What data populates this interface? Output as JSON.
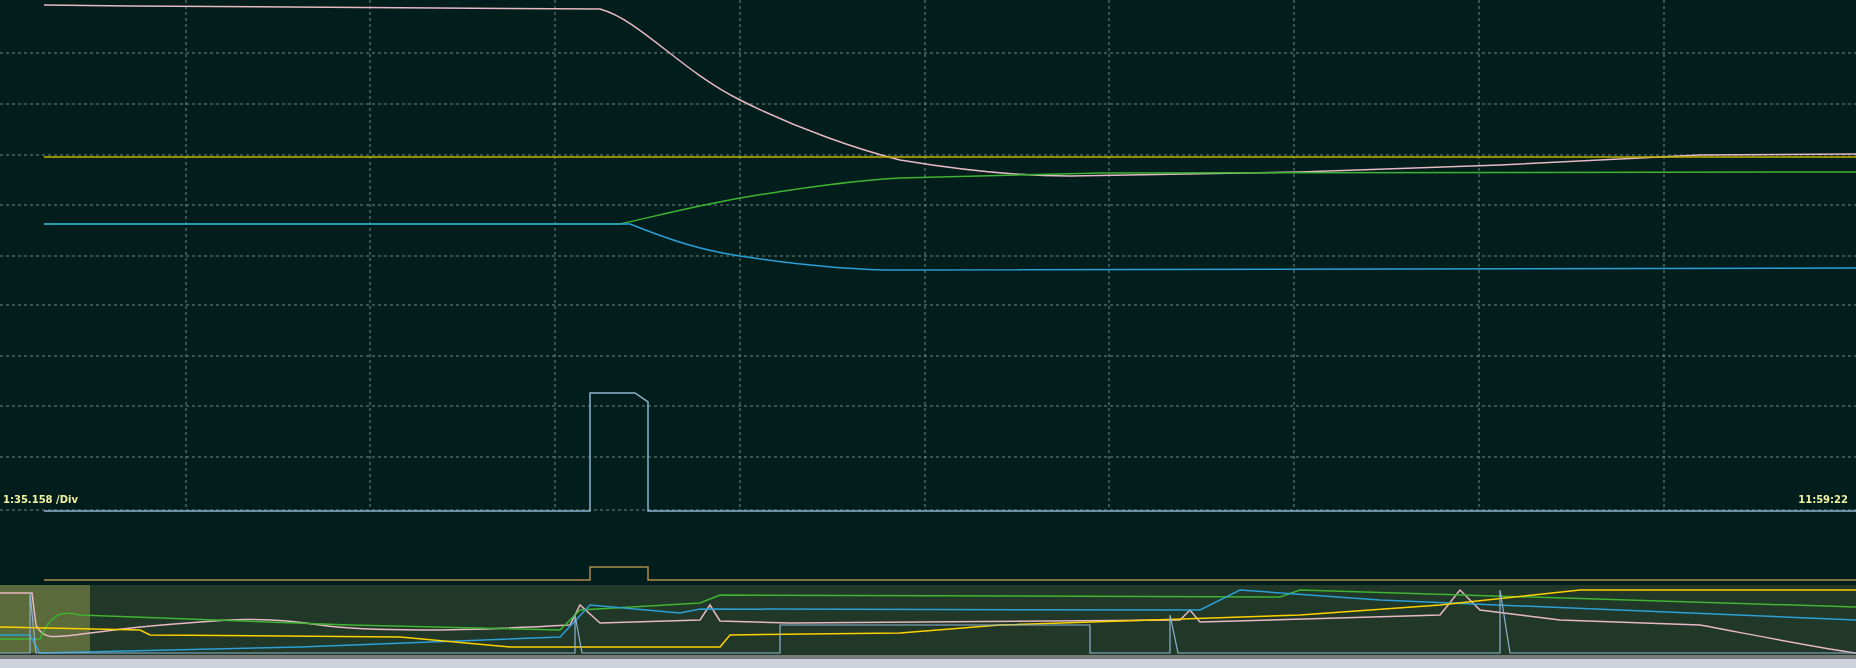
{
  "plot": {
    "scale_label": "1:35.158 /Div",
    "time_label": "11:59:22"
  }
}
